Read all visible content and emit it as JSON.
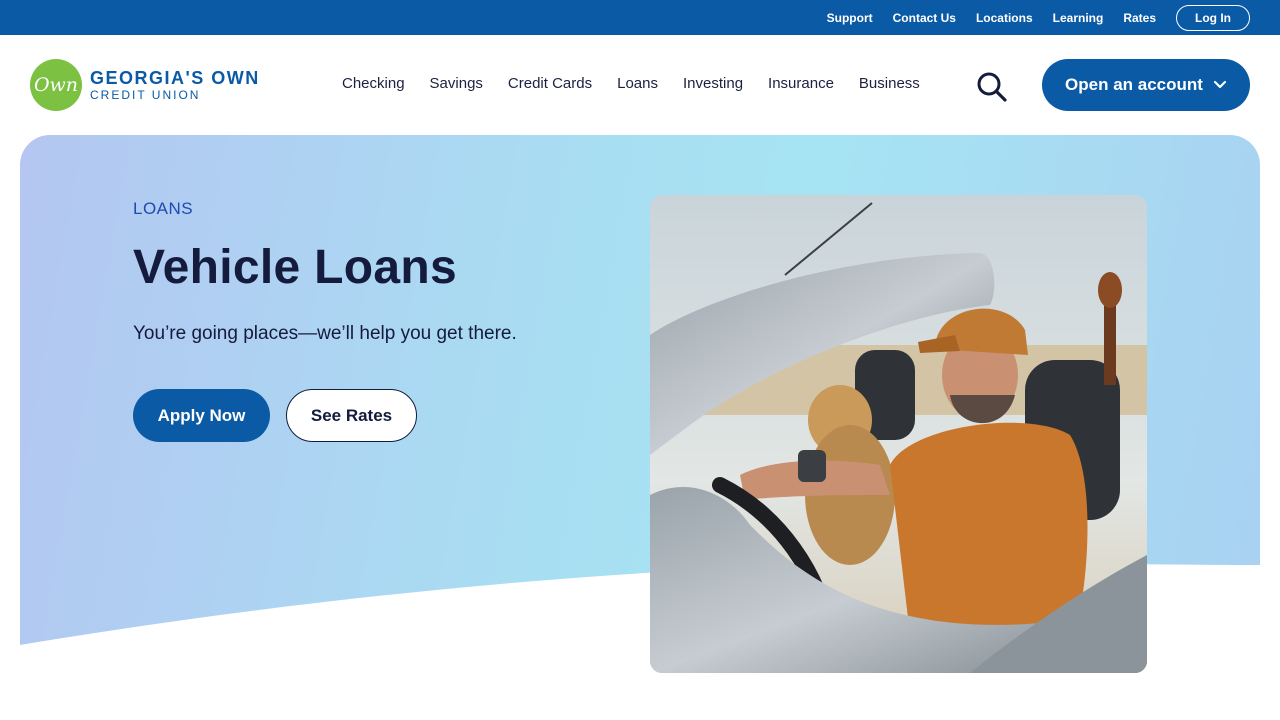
{
  "utility_nav": {
    "links": [
      "Support",
      "Contact Us",
      "Locations",
      "Learning",
      "Rates"
    ],
    "login_label": "Log In"
  },
  "brand": {
    "logo_mark": "Own",
    "name_line1": "GEORGIA'S OWN",
    "name_line2": "CREDIT UNION"
  },
  "main_nav": {
    "items": [
      "Checking",
      "Savings",
      "Credit Cards",
      "Loans",
      "Investing",
      "Insurance",
      "Business"
    ],
    "open_account_label": "Open an account"
  },
  "hero": {
    "eyebrow": "LOANS",
    "title": "Vehicle Loans",
    "subtitle": "You’re going places—we’ll help you get there.",
    "primary_cta": "Apply Now",
    "secondary_cta": "See Rates"
  },
  "icons": {
    "search": "search-icon",
    "chevron": "chevron-down-icon"
  },
  "colors": {
    "brand_blue": "#0a5aa6",
    "logo_green": "#7cc142",
    "text_dark": "#141b3d",
    "eyebrow_blue": "#1f4ab3"
  }
}
